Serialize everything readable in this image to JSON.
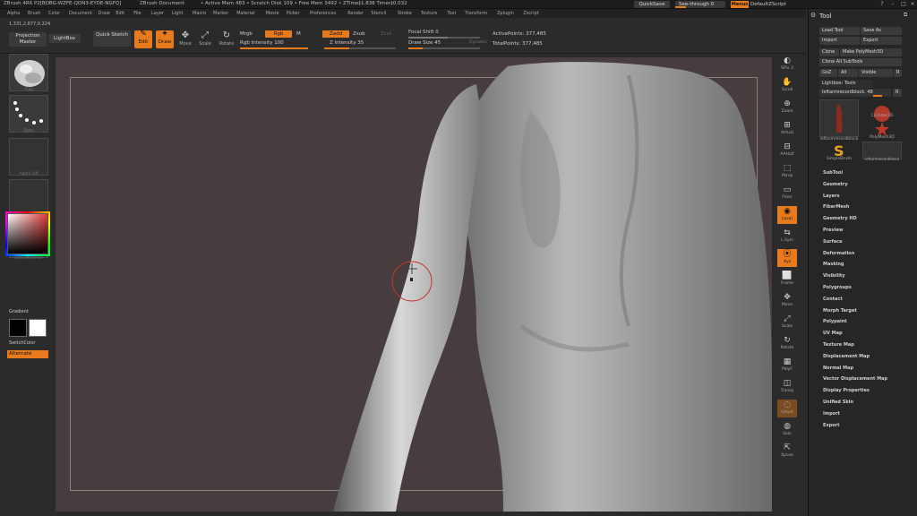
{
  "titlebar": {
    "app": "ZBrush 4R6 P2[BDBG-WZFE-QDN3-EYDE-NGFQ]",
    "document": "ZBrush Document",
    "stats": "• Active Mem 483 • Scratch Disk 109 • Free Mem 3492 • ZTime‡1.838 Timer‡0.032",
    "quicksave": "QuickSave",
    "see_through": "See-through 0",
    "menus": "Menus",
    "default_zscript": "DefaultZScript"
  },
  "menubar": [
    "Alpha",
    "Brush",
    "Color",
    "Document",
    "Draw",
    "Edit",
    "File",
    "Layer",
    "Light",
    "Macro",
    "Marker",
    "Material",
    "Movie",
    "Picker",
    "Preferences",
    "Render",
    "Stencil",
    "Stroke",
    "Texture",
    "Tool",
    "Transform",
    "Zplugin",
    "Zscript"
  ],
  "toolbar": {
    "coords": "1.331,2.877,0.224",
    "projection_master": "Projection Master",
    "lightbox": "LightBox",
    "quick_sketch": "Quick Sketch",
    "edit": "Edit",
    "draw": "Draw",
    "move": "Move",
    "scale": "Scale",
    "rotate": "Rotate",
    "mrgb": "Mrgb",
    "rgb": "Rgb",
    "m": "M",
    "rgb_intensity": "Rgb Intensity 100",
    "zadd": "Zadd",
    "zsub": "Zsub",
    "zcut": "Zcut",
    "z_intensity": "Z Intensity 35",
    "focal_shift": "Focal Shift 0",
    "draw_size": "Draw Size 45",
    "dynamic": "Dynamic",
    "active_points": "ActivePoints: 377,485",
    "total_points": "TotalPoints: 377,485"
  },
  "left_shelf": {
    "brush_label": "Clay",
    "stroke_label": "Dots",
    "alpha_label": "Alpha Off",
    "texture_label": "Texture Off",
    "material_label": "BasicMaterial",
    "gradient": "Gradient",
    "switch_color": "SwitchColor",
    "alternate": "Alternate"
  },
  "right_shelf": [
    "SPix 3",
    "Scroll",
    "Zoom",
    "Actual",
    "AAHalf",
    "Persp",
    "Floor",
    "Local",
    "L.Sym",
    "Xyz",
    "Frame",
    "Move",
    "Scale",
    "Rotate",
    "PolyF",
    "Transp",
    "Ghost",
    "Solo",
    "Xpose"
  ],
  "tool_panel": {
    "title": "Tool",
    "load_tool": "Load Tool",
    "save_as": "Save As",
    "import": "Import",
    "export": "Export",
    "clone": "Clone",
    "make_polymesh": "Make PolyMesh3D",
    "clone_all_subtools": "Clone All SubTools",
    "goz": "GoZ",
    "all": "All",
    "visible": "Visible",
    "r": "R",
    "lightbox_tools": "Lightbox› Tools",
    "current_tool": "leftarmrecordblock. 48",
    "current_tool_btn": "R",
    "thumbs": [
      "leftarmrecordblock",
      "Cylinder3D",
      "PolyMesh3D",
      "SimpleBrush",
      "leftarmrecordblock"
    ],
    "items": [
      "SubTool",
      "Geometry",
      "Layers",
      "FiberMesh",
      "Geometry HD",
      "Preview",
      "Surface",
      "Deformation",
      "Masking",
      "Visibility",
      "Polygroups",
      "Contact",
      "Morph Target",
      "Polypaint",
      "UV Map",
      "Texture Map",
      "Displacement Map",
      "Normal Map",
      "Vector Displacement Map",
      "Display Properties",
      "Unified Skin",
      "Import",
      "Export"
    ]
  },
  "colors": {
    "accent": "#e87a1e",
    "canvas_bg": "#473c3e",
    "panel_bg": "#2b2b2b"
  }
}
